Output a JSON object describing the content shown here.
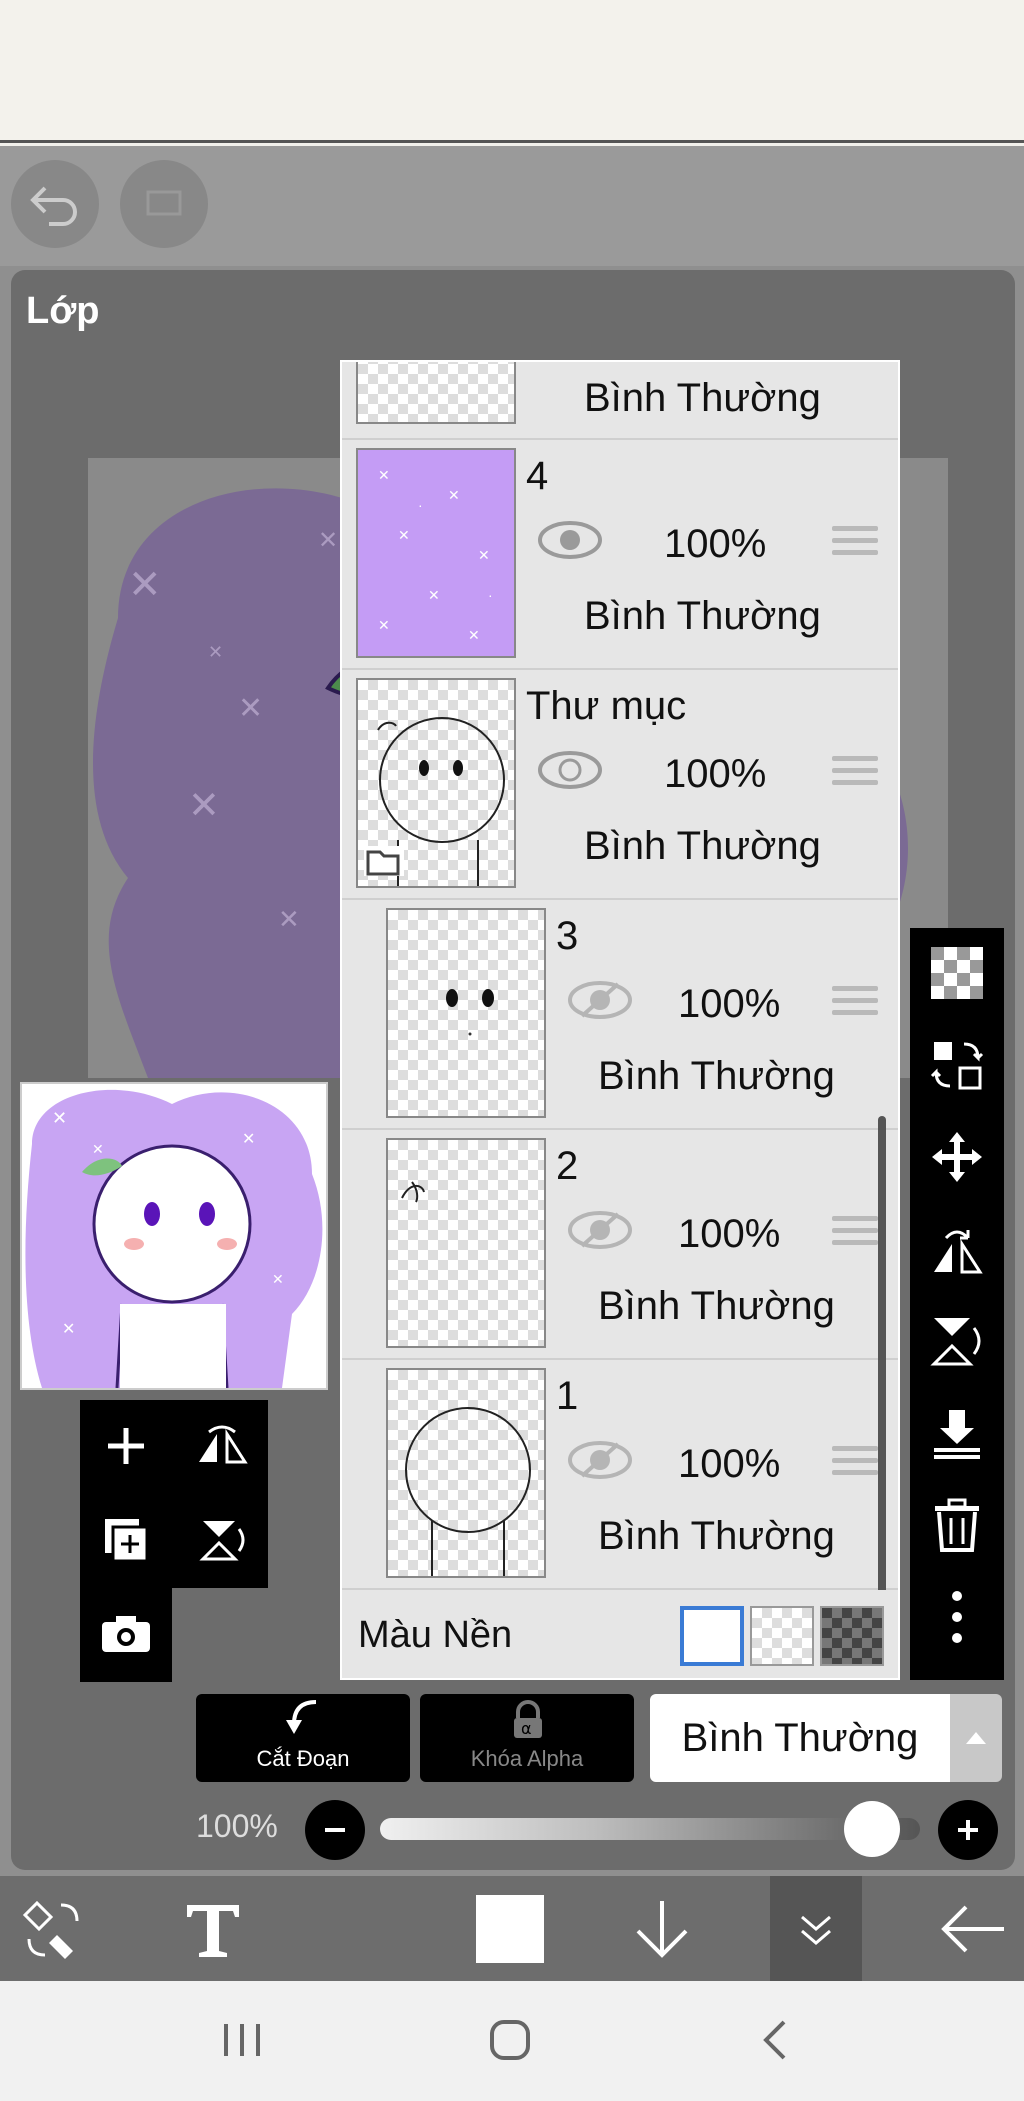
{
  "panel": {
    "title": "Lớp"
  },
  "layers": [
    {
      "name": "",
      "opacity": "",
      "mode": "Bình Thường",
      "visible": true
    },
    {
      "name": "4",
      "opacity": "100%",
      "mode": "Bình Thường",
      "visible": true
    },
    {
      "name": "Thư mục",
      "opacity": "100%",
      "mode": "Bình Thường",
      "visible": true,
      "is_folder": true
    },
    {
      "name": "3",
      "opacity": "100%",
      "mode": "Bình Thường",
      "visible": false
    },
    {
      "name": "2",
      "opacity": "100%",
      "mode": "Bình Thường",
      "visible": false
    },
    {
      "name": "1",
      "opacity": "100%",
      "mode": "Bình Thường",
      "visible": false
    }
  ],
  "background": {
    "label": "Màu Nền",
    "options": [
      "white",
      "transparent",
      "dark-checker"
    ],
    "selected": "white"
  },
  "buttons": {
    "clipping_label": "Cắt Đoạn",
    "alpha_lock_label": "Khóa Alpha"
  },
  "blend_mode": {
    "selected": "Bình Thường"
  },
  "opacity": {
    "value_label": "100%",
    "value": 100
  },
  "side_tools": [
    "checker-icon",
    "swap-icon",
    "move-icon",
    "flip-horizontal-icon",
    "flip-vertical-icon",
    "merge-down-icon",
    "trash-icon",
    "more-icon"
  ],
  "colors": {
    "accent": "#3a7bd5",
    "purple": "#c49cf5",
    "panel": "#6c6c6c"
  }
}
